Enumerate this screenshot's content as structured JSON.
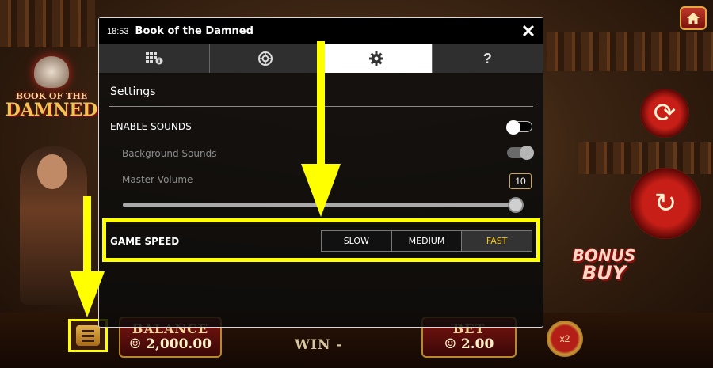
{
  "game": {
    "logo_line1": "BOOK OF THE",
    "logo_line2": "DAMNED",
    "bonus_line1": "BONUS",
    "bonus_line2": "BUY"
  },
  "dialog": {
    "time": "18:53",
    "title": "Book of the Damned",
    "close_symbol": "✕",
    "tabs": [
      {
        "icon": "paytable-icon",
        "active": false
      },
      {
        "icon": "autoplay-icon",
        "active": false
      },
      {
        "icon": "gear-icon",
        "active": true
      },
      {
        "icon": "help-icon",
        "label": "?",
        "active": false
      }
    ],
    "settings": {
      "heading": "Settings",
      "enable_sounds_label": "ENABLE SOUNDS",
      "enable_sounds_on": true,
      "background_sounds_label": "Background Sounds",
      "background_sounds_on": true,
      "master_volume_label": "Master Volume",
      "master_volume_value": "10",
      "master_volume_fraction": 1.0,
      "game_speed_label": "GAME SPEED",
      "speed_options": [
        "SLOW",
        "MEDIUM",
        "FAST"
      ],
      "speed_selected": "FAST"
    }
  },
  "bottom": {
    "balance_label": "BALANCE",
    "balance_value": "☺ 2,000.00",
    "win_label": "WIN  -",
    "bet_label": "BET",
    "bet_value": "☺ 2.00",
    "multiplier": "x2"
  },
  "colors": {
    "highlight": "#ffff00",
    "selected_speed": "#f5c518"
  }
}
